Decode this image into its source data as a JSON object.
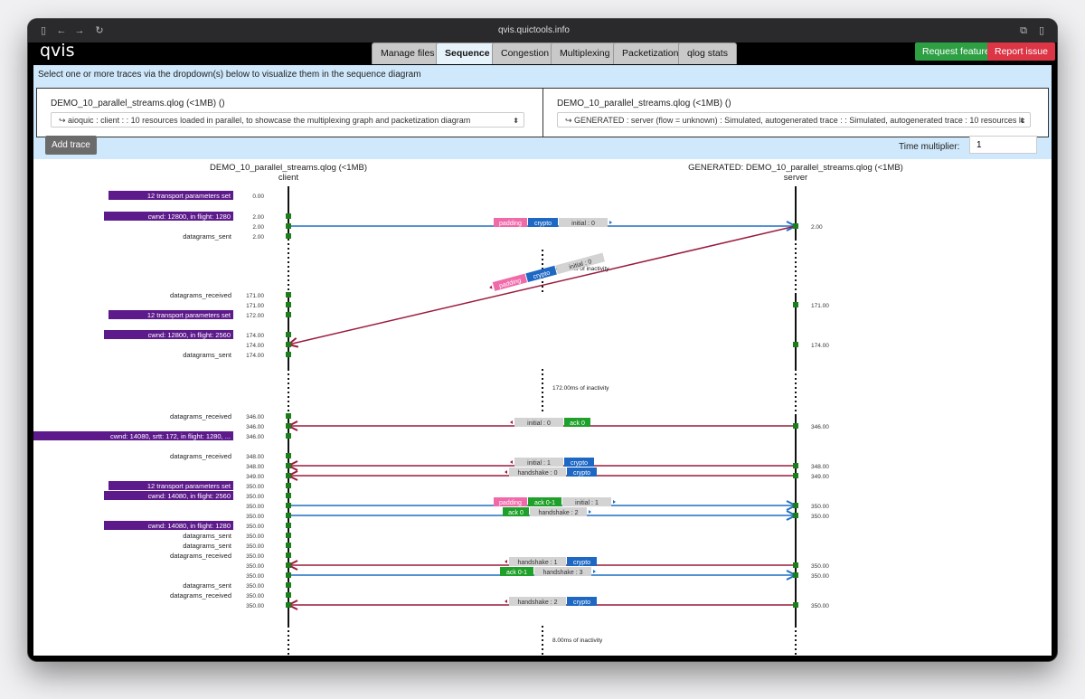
{
  "browser": {
    "url": "qvis.quictools.info"
  },
  "app": {
    "brand": "qvis"
  },
  "tabs": [
    "Manage files",
    "Sequence",
    "Congestion",
    "Multiplexing",
    "Packetization",
    "qlog stats"
  ],
  "header_buttons": {
    "request": "Request feature",
    "report": "Report issue"
  },
  "panel": {
    "instruction": "Select one or more traces via the dropdown(s) below to visualize them in the sequence diagram",
    "left_trace": {
      "title": "DEMO_10_parallel_streams.qlog (<1MB) ()",
      "selected": "↪ aioquic : client : : 10 resources loaded in parallel, to showcase the multiplexing graph and packetization diagram"
    },
    "right_trace": {
      "title": "DEMO_10_parallel_streams.qlog (<1MB) ()",
      "selected": "↪ GENERATED : server (flow = unknown) : Simulated, autogenerated trace : : Simulated, autogenerated trace : 10 resources lc"
    },
    "add_trace": "Add trace",
    "time_multiplier_label": "Time multiplier:",
    "time_multiplier_value": "1"
  },
  "diagram": {
    "client_title": "DEMO_10_parallel_streams.qlog (<1MB)",
    "client_sub": "client",
    "server_title": "GENERATED: DEMO_10_parallel_streams.qlog (<1MB)",
    "server_sub": "server",
    "colors": {
      "purple": "#5d1a8b",
      "blue": "#1f6fc1",
      "red": "#9a1b3d",
      "green": "#1a7f1a",
      "pink": "#f06aaa",
      "gray": "#d3d3d3",
      "ack": "#1fa02a",
      "crypto": "#1e68c4"
    },
    "client_events": [
      {
        "t": "0.00",
        "label": "12 transport parameters set",
        "box": true,
        "dot": false
      },
      {
        "t": "2.00",
        "label": "cwnd: 12800, in flight: 1280",
        "box": true,
        "dot": true
      },
      {
        "t": "2.00",
        "label": "",
        "box": false,
        "dot": true
      },
      {
        "t": "2.00",
        "label": "datagrams_sent",
        "box": false,
        "dot": true
      },
      {
        "t": "171.00",
        "label": "datagrams_received",
        "box": false,
        "dot": true
      },
      {
        "t": "171.00",
        "label": "",
        "box": false,
        "dot": true
      },
      {
        "t": "172.00",
        "label": "12 transport parameters set",
        "box": true,
        "dot": true
      },
      {
        "t": "174.00",
        "label": "cwnd: 12800, in flight: 2560",
        "box": true,
        "dot": true
      },
      {
        "t": "174.00",
        "label": "",
        "box": false,
        "dot": true
      },
      {
        "t": "174.00",
        "label": "datagrams_sent",
        "box": false,
        "dot": true
      },
      {
        "t": "346.00",
        "label": "datagrams_received",
        "box": false,
        "dot": true
      },
      {
        "t": "346.00",
        "label": "",
        "box": false,
        "dot": true
      },
      {
        "t": "346.00",
        "label": "cwnd: 14080, srtt: 172, in flight: 1280, ...",
        "box": true,
        "dot": true
      },
      {
        "t": "348.00",
        "label": "datagrams_received",
        "box": false,
        "dot": true
      },
      {
        "t": "348.00",
        "label": "",
        "box": false,
        "dot": true
      },
      {
        "t": "349.00",
        "label": "",
        "box": false,
        "dot": true
      },
      {
        "t": "350.00",
        "label": "12 transport parameters set",
        "box": true,
        "dot": true
      },
      {
        "t": "350.00",
        "label": "cwnd: 14080, in flight: 2560",
        "box": true,
        "dot": true
      },
      {
        "t": "350.00",
        "label": "",
        "box": false,
        "dot": true
      },
      {
        "t": "350.00",
        "label": "",
        "box": false,
        "dot": true
      },
      {
        "t": "350.00",
        "label": "cwnd: 14080, in flight: 1280",
        "box": true,
        "dot": true
      },
      {
        "t": "350.00",
        "label": "datagrams_sent",
        "box": false,
        "dot": true
      },
      {
        "t": "350.00",
        "label": "datagrams_sent",
        "box": false,
        "dot": true
      },
      {
        "t": "350.00",
        "label": "datagrams_received",
        "box": false,
        "dot": true
      },
      {
        "t": "350.00",
        "label": "",
        "box": false,
        "dot": true
      },
      {
        "t": "350.00",
        "label": "",
        "box": false,
        "dot": true
      },
      {
        "t": "350.00",
        "label": "datagrams_sent",
        "box": false,
        "dot": true
      },
      {
        "t": "350.00",
        "label": "datagrams_received",
        "box": false,
        "dot": true
      },
      {
        "t": "350.00",
        "label": "",
        "box": false,
        "dot": true
      }
    ],
    "server_events": [
      "2.00",
      "171.00",
      "174.00",
      "346.00",
      "348.00",
      "349.00",
      "350.00",
      "350.00",
      "350.00",
      "350.00",
      "350.00"
    ],
    "inactivity": [
      "169.00ms of inactivity",
      "172.00ms of inactivity",
      "8.00ms of inactivity"
    ],
    "packets": [
      {
        "dir": "c2s",
        "tags": [
          {
            "text": "padding",
            "kind": "pink"
          },
          {
            "text": "crypto",
            "kind": "crypto"
          },
          {
            "text": "initial : 0",
            "kind": "gray"
          }
        ]
      },
      {
        "dir": "s2c",
        "tags": [
          {
            "text": "padding",
            "kind": "pink"
          },
          {
            "text": "crypto",
            "kind": "crypto"
          },
          {
            "text": "initial : 0",
            "kind": "gray"
          }
        ]
      },
      {
        "dir": "s2c",
        "tags": [
          {
            "text": "initial : 0",
            "kind": "gray"
          },
          {
            "text": "ack 0",
            "kind": "ack"
          }
        ]
      },
      {
        "dir": "s2c",
        "tags": [
          {
            "text": "initial : 1",
            "kind": "gray"
          },
          {
            "text": "crypto",
            "kind": "crypto"
          }
        ]
      },
      {
        "dir": "s2c",
        "tags": [
          {
            "text": "handshake : 0",
            "kind": "gray"
          },
          {
            "text": "crypto",
            "kind": "crypto"
          }
        ]
      },
      {
        "dir": "c2s",
        "tags": [
          {
            "text": "padding",
            "kind": "pink"
          },
          {
            "text": "ack 0-1",
            "kind": "ack"
          },
          {
            "text": "initial : 1",
            "kind": "gray"
          }
        ]
      },
      {
        "dir": "c2s",
        "tags": [
          {
            "text": "ack 0",
            "kind": "ack"
          },
          {
            "text": "handshake : 2",
            "kind": "gray"
          }
        ]
      },
      {
        "dir": "s2c",
        "tags": [
          {
            "text": "handshake : 1",
            "kind": "gray"
          },
          {
            "text": "crypto",
            "kind": "crypto"
          }
        ]
      },
      {
        "dir": "c2s",
        "tags": [
          {
            "text": "ack 0-1",
            "kind": "ack"
          },
          {
            "text": "handshake : 3",
            "kind": "gray"
          }
        ]
      },
      {
        "dir": "s2c",
        "tags": [
          {
            "text": "handshake : 2",
            "kind": "gray"
          },
          {
            "text": "crypto",
            "kind": "crypto"
          }
        ]
      }
    ]
  }
}
